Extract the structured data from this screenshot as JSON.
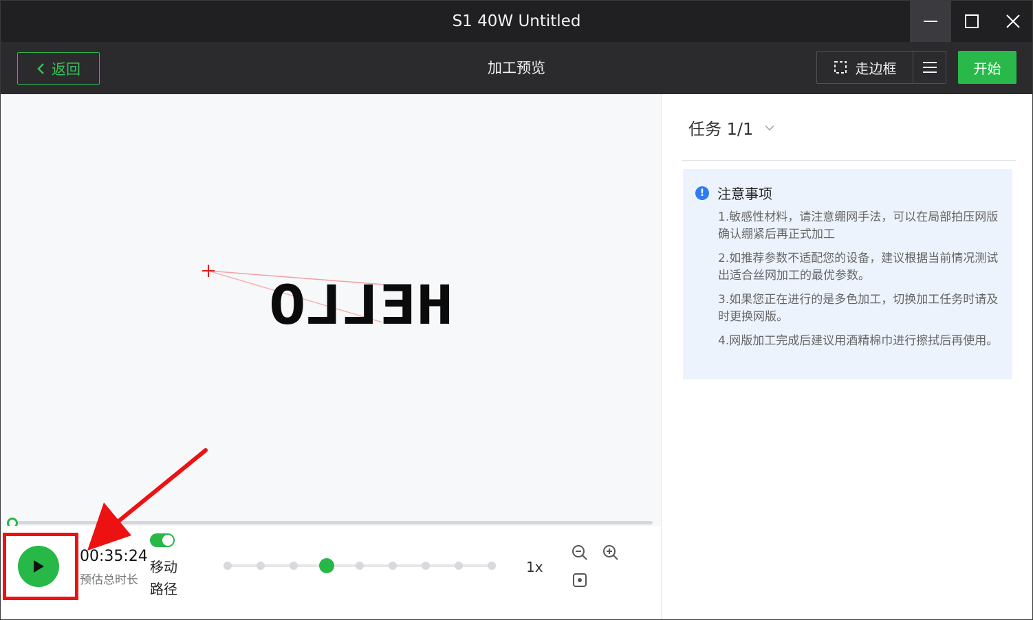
{
  "window": {
    "title": "S1 40W Untitled"
  },
  "toolbar": {
    "back_label": "返回",
    "page_title": "加工预览",
    "frame_label": "走边框",
    "start_label": "开始"
  },
  "canvas": {
    "preview_text": "HELLO",
    "mirrored": true,
    "progress": 0.0
  },
  "player": {
    "estimated_time": "00:35:24",
    "estimated_time_label": "预估总时长",
    "move_path_label": "移动路径",
    "move_path_enabled": true,
    "speed_label": "1x",
    "speed_steps": 9,
    "speed_active_index": 3
  },
  "side": {
    "task_label": "任务 1/1",
    "notice_title": "注意事项",
    "notices": [
      "1.敏感性材料，请注意绷网手法，可以在局部拍压网版确认绷紧后再正式加工",
      "2.如推荐参数不适配您的设备，建议根据当前情况测试出适合丝网加工的最优参数。",
      "3.如果您正在进行的是多色加工，切换加工任务时请及时更换网版。",
      "4.网版加工完成后建议用酒精棉巾进行擦拭后再使用。"
    ]
  },
  "colors": {
    "accent": "#27b847",
    "annotation": "#ee1111",
    "info": "#2f7bf0"
  }
}
